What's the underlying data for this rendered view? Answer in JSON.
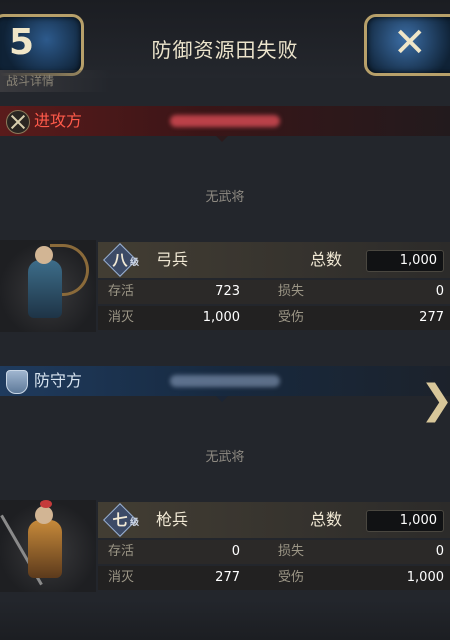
{
  "header": {
    "title": "防御资源田失败",
    "sub_label": "战斗详情",
    "back_symbol": "5",
    "close_symbol": "✕"
  },
  "attacker": {
    "label": "进攻方",
    "no_general": "无武将",
    "unit": {
      "rank": "八",
      "rank_suffix": "级",
      "name": "弓兵",
      "total_label": "总数",
      "total": "1,000",
      "survive_label": "存活",
      "survive": "723",
      "loss_label": "损失",
      "loss": "0",
      "kill_label": "消灭",
      "kill": "1,000",
      "wound_label": "受伤",
      "wound": "277"
    }
  },
  "defender": {
    "label": "防守方",
    "no_general": "无武将",
    "next_symbol": "❯",
    "unit": {
      "rank": "七",
      "rank_suffix": "级",
      "name": "枪兵",
      "total_label": "总数",
      "total": "1,000",
      "survive_label": "存活",
      "survive": "0",
      "loss_label": "损失",
      "loss": "0",
      "kill_label": "消灭",
      "kill": "277",
      "wound_label": "受伤",
      "wound": "1,000"
    }
  }
}
